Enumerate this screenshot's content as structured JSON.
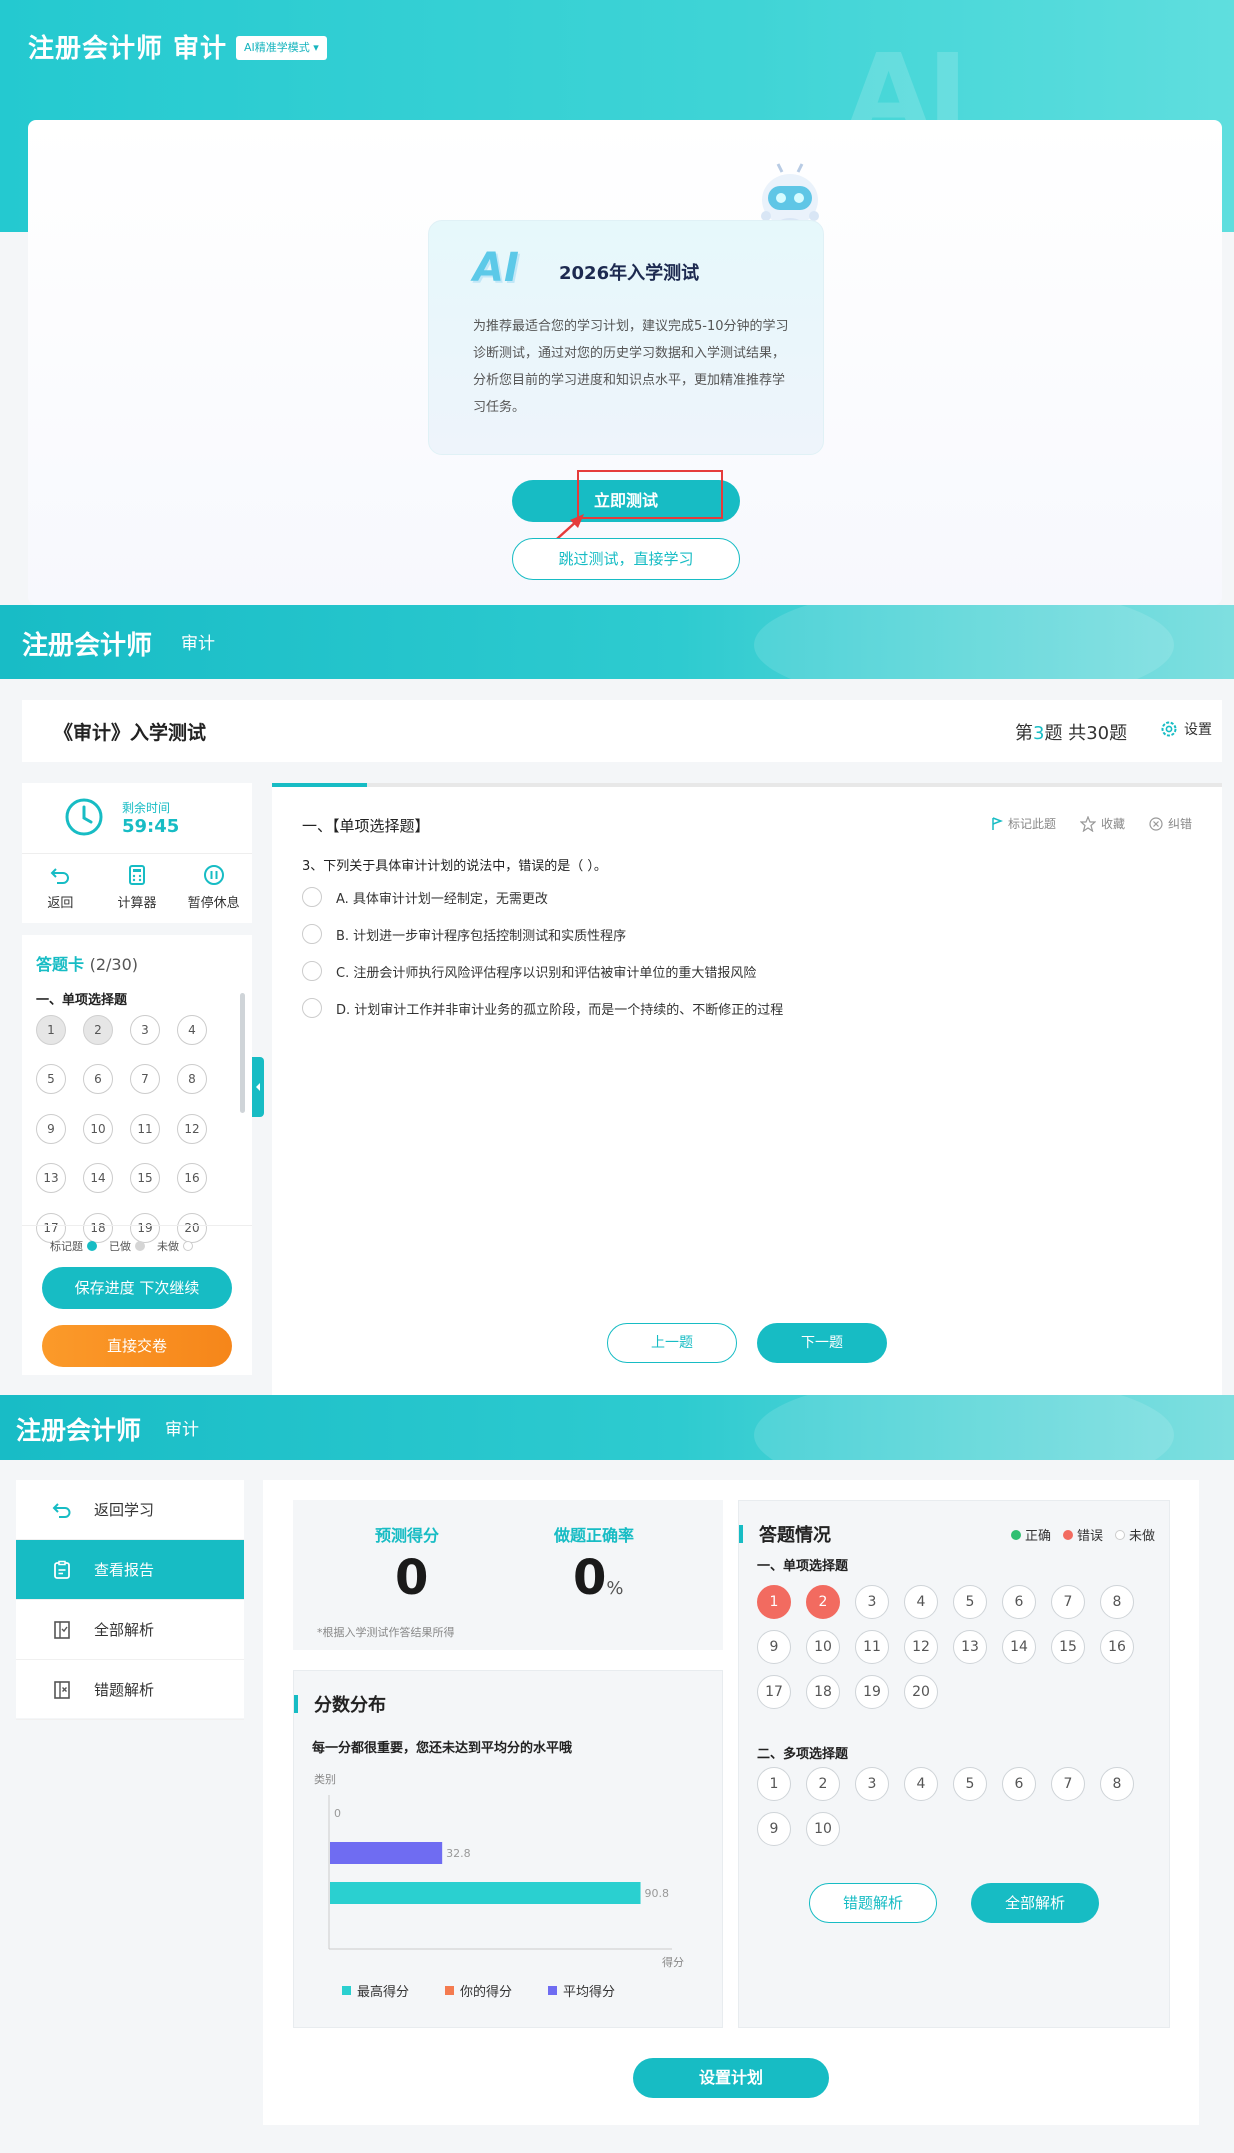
{
  "section1": {
    "title": "注册会计师 审计",
    "mode_badge": "AI精准学模式 ▾",
    "banner_ai": "AI",
    "ai_glyph": "AI",
    "intro_title": "2026年入学测试",
    "intro_desc": "为推荐最适合您的学习计划，建议完成5-10分钟的学习诊断测试，通过对您的历史学习数据和入学测试结果，分析您目前的学习进度和知识点水平，更加精准推荐学习任务。",
    "start_button": "立即测试",
    "skip_button": "跳过测试，直接学习",
    "highlight_color": "#e53b3b"
  },
  "section2": {
    "header_title": "注册会计师",
    "header_subject": "审计",
    "test_title": "《审计》入学测试",
    "progress_prefix": "第",
    "progress_current": "3",
    "progress_mid": "题 共",
    "progress_total": "30",
    "progress_suffix": "题",
    "settings_label": "设置",
    "timer_label": "剩余时间",
    "timer_value": "59:45",
    "tools": [
      {
        "label": "返回",
        "icon": "back-icon"
      },
      {
        "label": "计算器",
        "icon": "calculator-icon"
      },
      {
        "label": "暂停休息",
        "icon": "pause-icon"
      }
    ],
    "answer_card_title": "答题卡",
    "answer_card_count": "(2/30)",
    "answer_card_section": "一、单项选择题",
    "answer_numbers": [
      {
        "n": "1",
        "done": true
      },
      {
        "n": "2",
        "done": true
      },
      {
        "n": "3",
        "done": false
      },
      {
        "n": "4",
        "done": false
      },
      {
        "n": "5",
        "done": false
      },
      {
        "n": "6",
        "done": false
      },
      {
        "n": "7",
        "done": false
      },
      {
        "n": "8",
        "done": false
      },
      {
        "n": "9",
        "done": false
      },
      {
        "n": "10",
        "done": false
      },
      {
        "n": "11",
        "done": false
      },
      {
        "n": "12",
        "done": false
      },
      {
        "n": "13",
        "done": false
      },
      {
        "n": "14",
        "done": false
      },
      {
        "n": "15",
        "done": false
      },
      {
        "n": "16",
        "done": false
      },
      {
        "n": "17",
        "done": false
      },
      {
        "n": "18",
        "done": false
      },
      {
        "n": "19",
        "done": false
      },
      {
        "n": "20",
        "done": false
      }
    ],
    "legend": {
      "marked": "标记题",
      "done": "已做",
      "undone": "未做"
    },
    "save_button": "保存进度 下次继续",
    "submit_button": "直接交卷",
    "question_progress": 0.1,
    "question_type": "一、【单项选择题】",
    "actions": {
      "mark": "标记此题",
      "favorite": "收藏",
      "report": "纠错"
    },
    "question_stem": "3、下列关于具体审计计划的说法中，错误的是（    ）。",
    "options": [
      "A. 具体审计计划一经制定，无需更改",
      "B. 计划进一步审计程序包括控制测试和实质性程序",
      "C. 注册会计师执行风险评估程序以识别和评估被审计单位的重大错报风险",
      "D. 计划审计工作并非审计业务的孤立阶段，而是一个持续的、不断修正的过程"
    ],
    "prev_button": "上一题",
    "next_button": "下一题"
  },
  "section3": {
    "header_title": "注册会计师",
    "header_subject": "审计",
    "menu": [
      {
        "label": "返回学习",
        "icon": "return-icon",
        "active": false
      },
      {
        "label": "查看报告",
        "icon": "report-icon",
        "active": true
      },
      {
        "label": "全部解析",
        "icon": "analysis-icon",
        "active": false
      },
      {
        "label": "错题解析",
        "icon": "wrong-analysis-icon",
        "active": false
      }
    ],
    "predicted_label": "预测得分",
    "predicted_value": "0",
    "accuracy_label": "做题正确率",
    "accuracy_value": "0",
    "accuracy_unit": "%",
    "score_note": "*根据入学测试作答结果所得",
    "dist_title": "分数分布",
    "dist_subtitle": "每一分都很重要，您还未达到平均分的水平哦",
    "answers_title": "答题情况",
    "answer_legend": {
      "correct": "正确",
      "wrong": "错误",
      "undone": "未做"
    },
    "single_section": "一、单项选择题",
    "single_items": [
      {
        "n": "1",
        "status": "wrong"
      },
      {
        "n": "2",
        "status": "wrong"
      },
      {
        "n": "3",
        "status": "undone"
      },
      {
        "n": "4",
        "status": "undone"
      },
      {
        "n": "5",
        "status": "undone"
      },
      {
        "n": "6",
        "status": "undone"
      },
      {
        "n": "7",
        "status": "undone"
      },
      {
        "n": "8",
        "status": "undone"
      },
      {
        "n": "9",
        "status": "undone"
      },
      {
        "n": "10",
        "status": "undone"
      },
      {
        "n": "11",
        "status": "undone"
      },
      {
        "n": "12",
        "status": "undone"
      },
      {
        "n": "13",
        "status": "undone"
      },
      {
        "n": "14",
        "status": "undone"
      },
      {
        "n": "15",
        "status": "undone"
      },
      {
        "n": "16",
        "status": "undone"
      },
      {
        "n": "17",
        "status": "undone"
      },
      {
        "n": "18",
        "status": "undone"
      },
      {
        "n": "19",
        "status": "undone"
      },
      {
        "n": "20",
        "status": "undone"
      }
    ],
    "multi_section": "二、多项选择题",
    "multi_items": [
      {
        "n": "1",
        "status": "undone"
      },
      {
        "n": "2",
        "status": "undone"
      },
      {
        "n": "3",
        "status": "undone"
      },
      {
        "n": "4",
        "status": "undone"
      },
      {
        "n": "5",
        "status": "undone"
      },
      {
        "n": "6",
        "status": "undone"
      },
      {
        "n": "7",
        "status": "undone"
      },
      {
        "n": "8",
        "status": "undone"
      },
      {
        "n": "9",
        "status": "undone"
      },
      {
        "n": "10",
        "status": "undone"
      }
    ],
    "wrong_button": "错题解析",
    "all_button": "全部解析",
    "plan_button": "设置计划",
    "colors": {
      "accent": "#17bcc4",
      "wrong": "#f26b60",
      "correct": "#2fbf71",
      "submit": "#f6861a"
    }
  },
  "chart_data": {
    "type": "bar",
    "orientation": "horizontal",
    "ylabel": "类别",
    "xlabel": "得分",
    "categories": [
      "你的得分",
      "平均得分",
      "最高得分"
    ],
    "values": [
      0,
      32.8,
      90.8
    ],
    "value_labels": [
      "0",
      "32.8",
      "90.8"
    ],
    "series": [
      {
        "name": "最高得分",
        "color": "#2ad0d0"
      },
      {
        "name": "你的得分",
        "color": "#f47b50"
      },
      {
        "name": "平均得分",
        "color": "#6f6cf2"
      }
    ],
    "xlim": [
      0,
      100
    ],
    "grid": false,
    "legend": "bottom"
  }
}
